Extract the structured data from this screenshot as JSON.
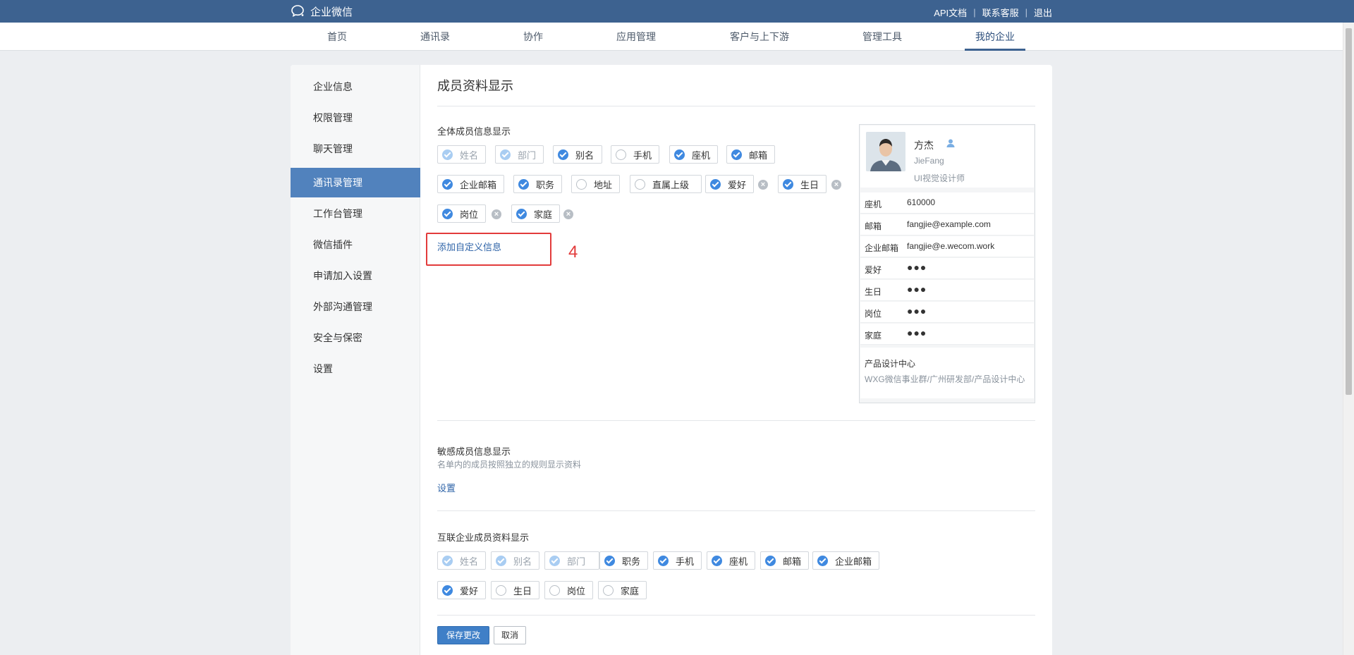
{
  "brand": {
    "name": "企业微信"
  },
  "top_links": [
    "API文档",
    "联系客服",
    "退出"
  ],
  "nav": [
    "首页",
    "通讯录",
    "协作",
    "应用管理",
    "客户与上下游",
    "管理工具",
    "我的企业"
  ],
  "nav_active": "我的企业",
  "sidebar": [
    "企业信息",
    "权限管理",
    "聊天管理",
    "通讯录管理",
    "工作台管理",
    "微信插件",
    "申请加入设置",
    "外部沟通管理",
    "安全与保密",
    "设置"
  ],
  "sidebar_active": "通讯录管理",
  "page_title": "成员资料显示",
  "all_members": {
    "title": "全体成员信息显示",
    "fields": [
      {
        "label": "姓名",
        "state": "dim"
      },
      {
        "label": "部门",
        "state": "dim"
      },
      {
        "label": "别名",
        "state": "on"
      },
      {
        "label": "手机",
        "state": "off"
      },
      {
        "label": "座机",
        "state": "on"
      },
      {
        "label": "邮箱",
        "state": "on"
      },
      {
        "label": "企业邮箱",
        "state": "on"
      },
      {
        "label": "职务",
        "state": "on"
      },
      {
        "label": "地址",
        "state": "off"
      },
      {
        "label": "直属上级",
        "state": "off"
      },
      {
        "label": "爱好",
        "state": "on",
        "removable": true
      },
      {
        "label": "生日",
        "state": "on",
        "removable": true
      },
      {
        "label": "岗位",
        "state": "on",
        "removable": true
      },
      {
        "label": "家庭",
        "state": "on",
        "removable": true
      }
    ],
    "add_custom": "添加自定义信息"
  },
  "annotation": {
    "step": "4",
    "color": "#e23b3b"
  },
  "preview": {
    "name": "方杰",
    "en_name": "JieFang",
    "job_title": "UI视觉设计师",
    "rows": [
      {
        "key": "座机",
        "value": "610000"
      },
      {
        "key": "邮箱",
        "value": "fangjie@example.com"
      },
      {
        "key": "企业邮箱",
        "value": "fangjie@e.wecom.work"
      },
      {
        "key": "爱好",
        "value": "●●●"
      },
      {
        "key": "生日",
        "value": "●●●"
      },
      {
        "key": "岗位",
        "value": "●●●"
      },
      {
        "key": "家庭",
        "value": "●●●"
      }
    ],
    "department": "产品设计中心",
    "department_path": "WXG微信事业群/广州研发部/产品设计中心"
  },
  "sensitive": {
    "title": "敏感成员信息显示",
    "desc": "名单内的成员按照独立的规则显示资料",
    "link": "设置"
  },
  "interconnect": {
    "title": "互联企业成员资料显示",
    "fields": [
      {
        "label": "姓名",
        "state": "dim"
      },
      {
        "label": "别名",
        "state": "dim"
      },
      {
        "label": "部门",
        "state": "dim"
      },
      {
        "label": "职务",
        "state": "on"
      },
      {
        "label": "手机",
        "state": "on"
      },
      {
        "label": "座机",
        "state": "on"
      },
      {
        "label": "邮箱",
        "state": "on"
      },
      {
        "label": "企业邮箱",
        "state": "on"
      },
      {
        "label": "爱好",
        "state": "on"
      },
      {
        "label": "生日",
        "state": "off"
      },
      {
        "label": "岗位",
        "state": "off"
      },
      {
        "label": "家庭",
        "state": "off"
      }
    ]
  },
  "actions": {
    "save": "保存更改",
    "cancel": "取消"
  },
  "colors": {
    "topbar": "#3d6290",
    "accent": "#5182bd",
    "check": "#3f89e0",
    "link": "#2f64a8"
  }
}
